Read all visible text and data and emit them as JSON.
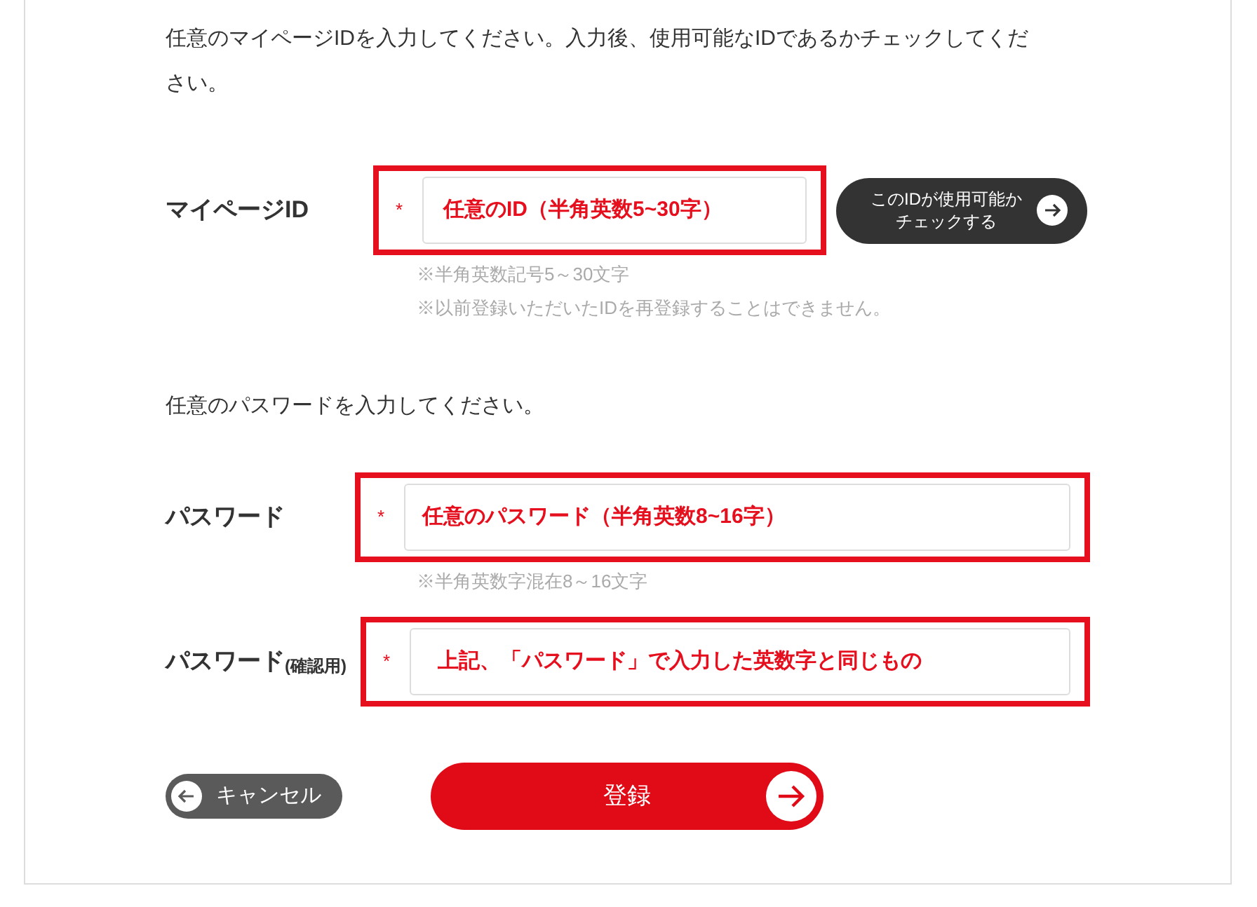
{
  "intro_id": "任意のマイページIDを入力してください。入力後、使用可能なIDであるかチェックしてください。",
  "id_row": {
    "label": "マイページID",
    "required": true,
    "required_mark": "*",
    "highlighted": true,
    "value": "任意のID（半角英数5~30字）",
    "check_button": [
      "このIDが使用可能か",
      "チェックする"
    ],
    "notes": [
      "※半角英数記号5～30文字",
      "※以前登録いただいたIDを再登録することはできません。"
    ]
  },
  "intro_password": "任意のパスワードを入力してください。",
  "password_row": {
    "label": "パスワード",
    "required": true,
    "required_mark": "*",
    "highlighted": true,
    "value": "任意のパスワード（半角英数8~16字）",
    "notes": [
      "※半角英数字混在8～16文字"
    ]
  },
  "confirm_row": {
    "label": "パスワード",
    "label_note": "(確認用)",
    "required": true,
    "required_mark": "*",
    "highlighted": true,
    "value": "上記、「パスワード」で入力した英数字と同じもの"
  },
  "buttons": {
    "cancel": "キャンセル",
    "submit": "登録"
  }
}
